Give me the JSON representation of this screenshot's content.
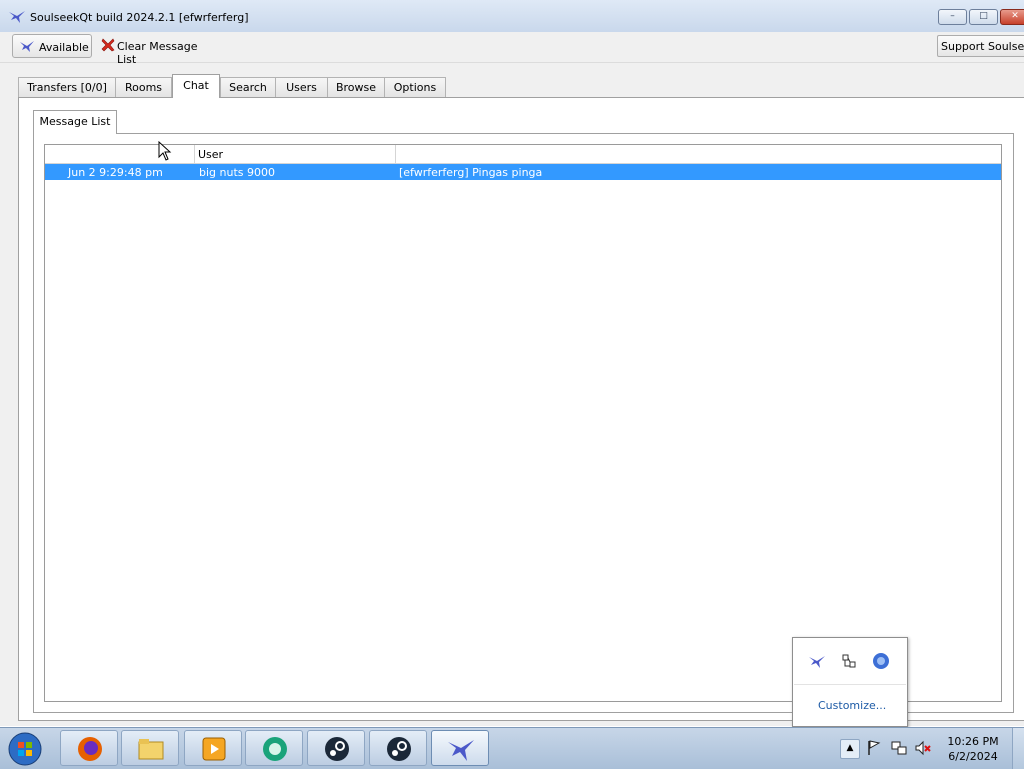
{
  "window": {
    "title": "SoulseekQt build 2024.2.1 [efwrferferg]",
    "controls": {
      "minimize": "–",
      "maximize": "□",
      "close": "✕"
    }
  },
  "toolbar": {
    "available_label": "Available",
    "clear_label": "Clear Message List",
    "support_label": "Support Soulseek"
  },
  "tabs": [
    {
      "label": "Transfers [0/0]"
    },
    {
      "label": "Rooms"
    },
    {
      "label": "Chat"
    },
    {
      "label": "Search"
    },
    {
      "label": "Users"
    },
    {
      "label": "Browse"
    },
    {
      "label": "Options"
    }
  ],
  "active_tab": "Chat",
  "subtabs": [
    {
      "label": "Message List"
    }
  ],
  "message_list": {
    "columns": [
      {
        "label": ""
      },
      {
        "label": "User"
      },
      {
        "label": ""
      }
    ],
    "rows": [
      {
        "time": "Jun 2 9:29:48 pm",
        "user": "big nuts 9000",
        "message": "[efwrferferg] Pingas pinga"
      }
    ]
  },
  "tray_popup": {
    "customize_label": "Customize..."
  },
  "taskbar": {
    "apps": [
      "firefox-icon",
      "file-explorer-icon",
      "media-player-icon",
      "browser-icon",
      "steam-icon",
      "steam-icon",
      "soulseek-icon"
    ],
    "clock_time": "10:26 PM",
    "clock_date": "6/2/2024"
  },
  "colors": {
    "selection": "#3399ff",
    "titlebar": "#c9d8ec",
    "taskbar": "#b4c8de",
    "link": "#1e5ba6"
  }
}
